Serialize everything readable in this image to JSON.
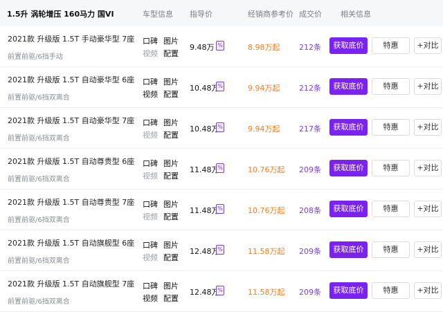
{
  "header": {
    "engine": "1.5升 涡轮增压 160马力 国VI",
    "col_model_info": "车型信息",
    "col_guide_price": "指导价",
    "col_dealer_price": "经销商参考价",
    "col_deal_price": "成交价",
    "col_related": "相关信息"
  },
  "buttons": {
    "get_price": "获取底价",
    "special": "特惠",
    "compare": "+对比"
  },
  "links": {
    "koubei": "口碑",
    "photos": "图片",
    "video": "视频",
    "config": "配置"
  },
  "calc_icon": "calculator-icon",
  "rows": [
    {
      "name": "2021款 升级版 1.5T 手动豪华型 7座",
      "spec": "前置前驱/6挡手动",
      "guide_price": "9.48万",
      "dealer_price": "8.98万起",
      "deals": "212条",
      "video_active": false
    },
    {
      "name": "2021款 升级版 1.5T 自动豪华型 6座",
      "spec": "前置前驱/6挡双离合",
      "guide_price": "10.48万",
      "dealer_price": "9.94万起",
      "deals": "212条",
      "video_active": true
    },
    {
      "name": "2021款 升级版 1.5T 自动豪华型 7座",
      "spec": "前置前驱/6挡双离合",
      "guide_price": "10.48万",
      "dealer_price": "9.94万起",
      "deals": "217条",
      "video_active": false
    },
    {
      "name": "2021款 升级版 1.5T 自动尊贵型 6座",
      "spec": "前置前驱/6挡双离合",
      "guide_price": "11.48万",
      "dealer_price": "10.76万起",
      "deals": "209条",
      "video_active": false
    },
    {
      "name": "2021款 升级版 1.5T 自动尊贵型 7座",
      "spec": "前置前驱/6挡双离合",
      "guide_price": "11.48万",
      "dealer_price": "10.76万起",
      "deals": "208条",
      "video_active": false
    },
    {
      "name": "2021款 升级版 1.5T 自动旗舰型 6座",
      "spec": "前置前驱/6挡双离合",
      "guide_price": "12.48万",
      "dealer_price": "11.58万起",
      "deals": "209条",
      "video_active": false
    },
    {
      "name": "2021款 升级版 1.5T 自动旗舰型 7座",
      "spec": "前置前驱/6挡双离合",
      "guide_price": "12.48万",
      "dealer_price": "11.58万起",
      "deals": "209条",
      "video_active": true
    }
  ]
}
